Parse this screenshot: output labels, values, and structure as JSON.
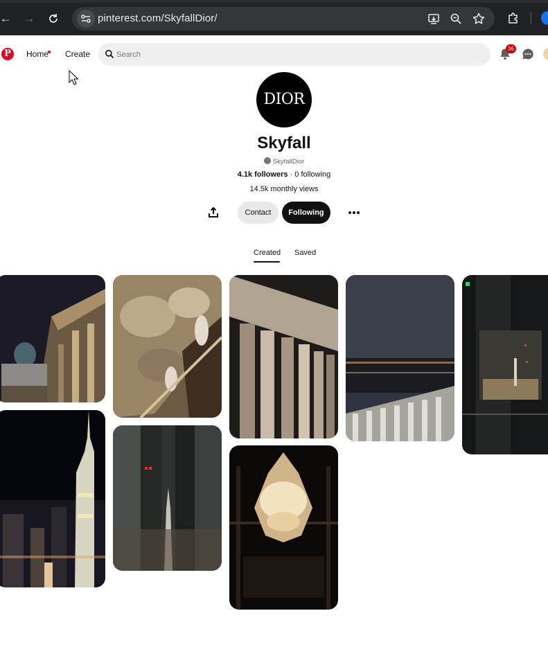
{
  "browser": {
    "url": "pinterest.com/SkyfallDior/"
  },
  "header": {
    "home_label": "Home",
    "create_label": "Create",
    "search_placeholder": "Search",
    "notification_count": "36"
  },
  "profile": {
    "avatar_text": "DIOR",
    "name": "Skyfall",
    "username": "SkyfallDior",
    "followers": "4.1k followers",
    "following_count": "0 following",
    "follow_separator": "·",
    "monthly_views": "14.5k monthly views",
    "contact_label": "Contact",
    "following_label": "Following"
  },
  "tabs": {
    "created_label": "Created",
    "saved_label": "Saved"
  },
  "pins": [
    {
      "subject": "neoclassical building facade at night with dome"
    },
    {
      "subject": "painted baroque ceiling fresco"
    },
    {
      "subject": "tall classical stone columns"
    },
    {
      "subject": "city skyline at dusk behind balustrade"
    },
    {
      "subject": "glass reflections overlooking city at night"
    },
    {
      "subject": "Empire State Building lit at night"
    },
    {
      "subject": "city at night seen between dark pillars"
    },
    {
      "subject": "crystal chandelier in dark room"
    }
  ]
}
